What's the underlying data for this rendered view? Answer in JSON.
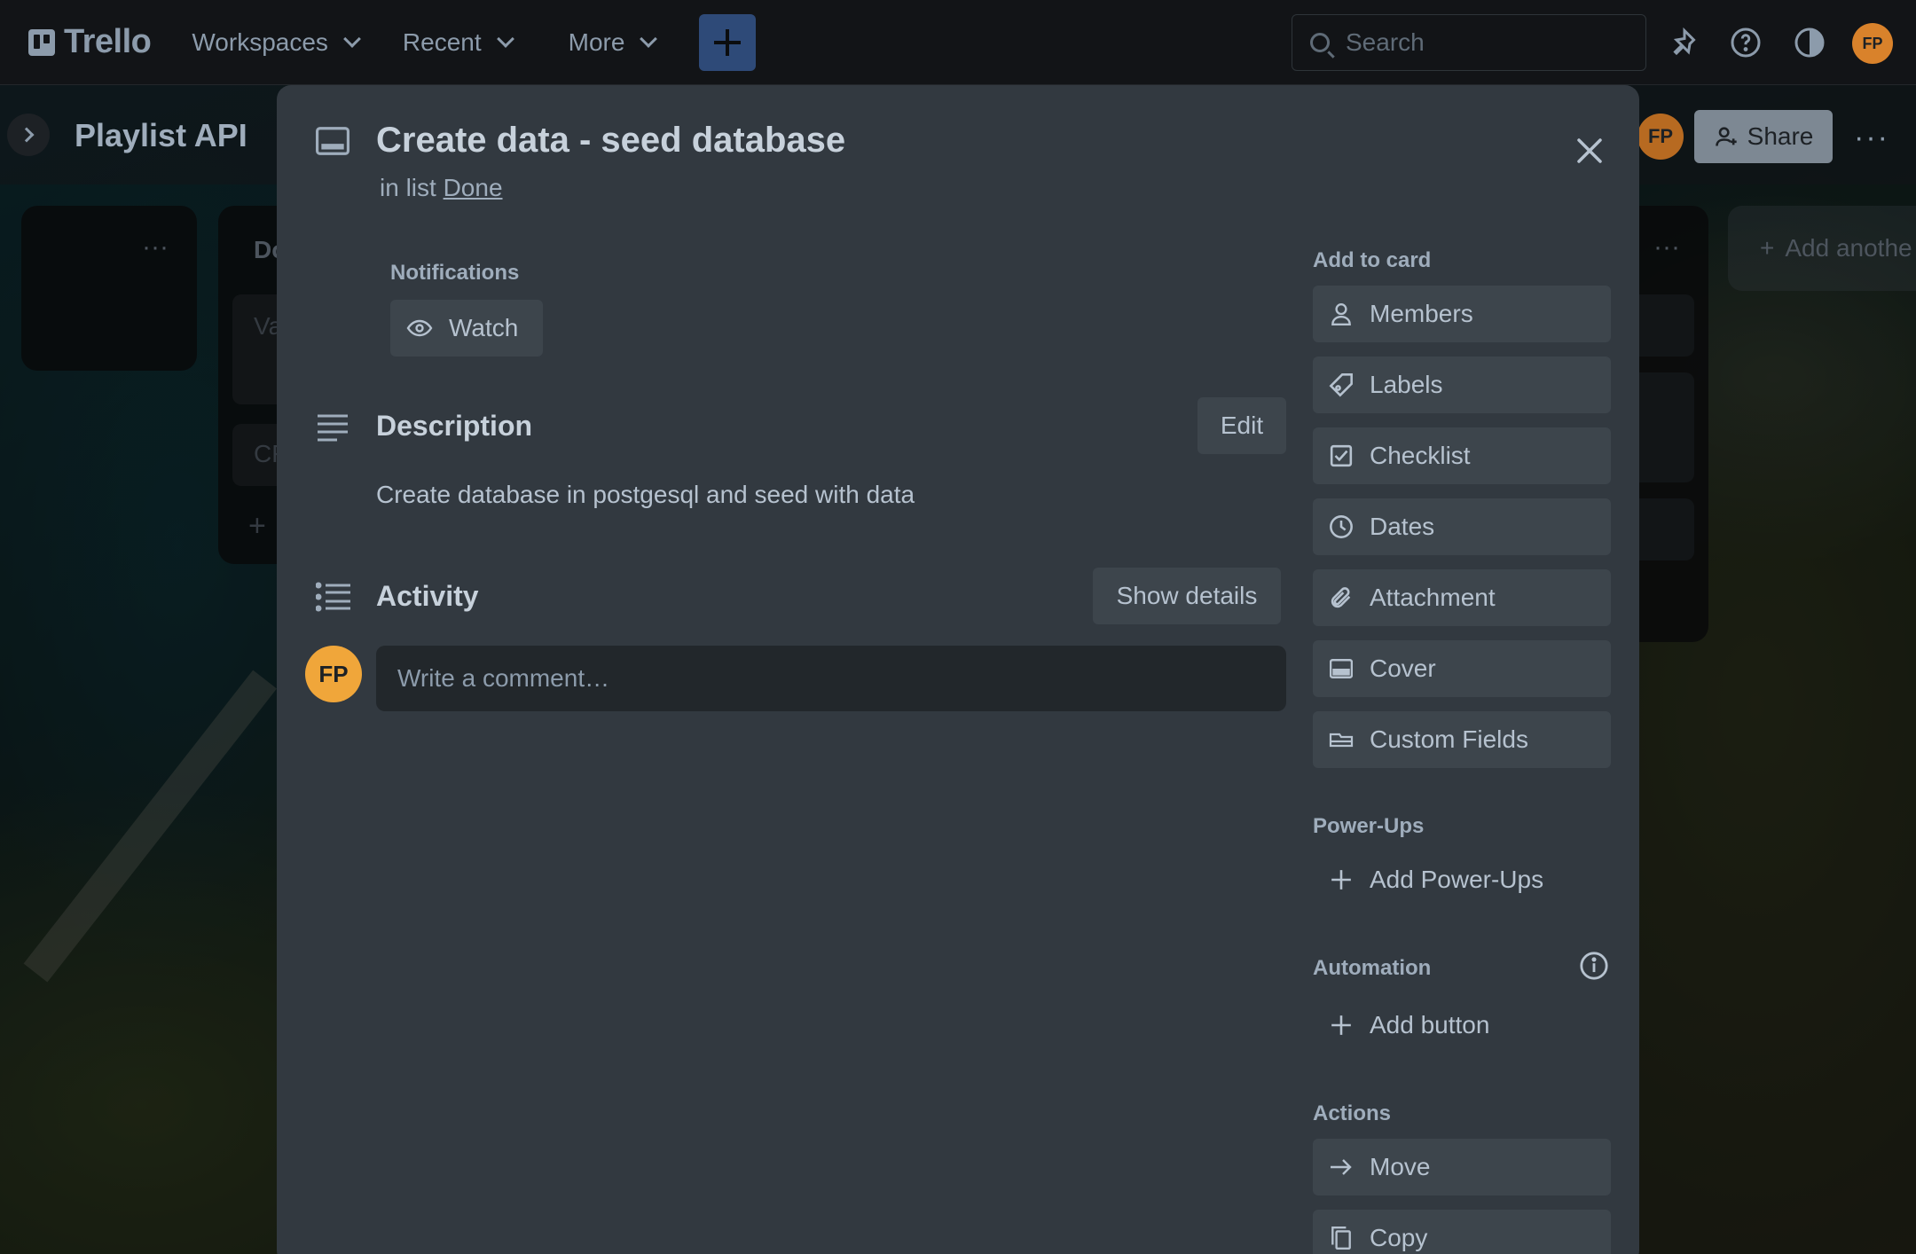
{
  "topnav": {
    "logo": "Trello",
    "menus": [
      "Workspaces",
      "Recent",
      "More"
    ],
    "search_placeholder": "Search",
    "user_initials": "FP"
  },
  "board": {
    "title": "Playlist API",
    "share_label": "Share",
    "member_initials": "FP",
    "add_list_label": "Add anothe",
    "list_partial_title": "Do",
    "card_partial_1": "Va",
    "card_partial_2": "CF"
  },
  "modal": {
    "title": "Create data - seed database",
    "in_list_prefix": "in list",
    "list_name": "Done",
    "notifications_label": "Notifications",
    "watch_label": "Watch",
    "description_title": "Description",
    "edit_label": "Edit",
    "description_text": "Create database in postgesql and seed with data",
    "activity_title": "Activity",
    "show_details_label": "Show details",
    "comment_avatar": "FP",
    "comment_placeholder": "Write a comment…"
  },
  "sidebar": {
    "add_to_card_label": "Add to card",
    "add_to_card": [
      {
        "label": "Members",
        "icon": "person-icon"
      },
      {
        "label": "Labels",
        "icon": "tag-icon"
      },
      {
        "label": "Checklist",
        "icon": "checkbox-icon"
      },
      {
        "label": "Dates",
        "icon": "clock-icon"
      },
      {
        "label": "Attachment",
        "icon": "paperclip-icon"
      },
      {
        "label": "Cover",
        "icon": "cover-icon"
      },
      {
        "label": "Custom Fields",
        "icon": "custom-fields-icon"
      }
    ],
    "power_ups_label": "Power-Ups",
    "add_power_ups": "Add Power-Ups",
    "automation_label": "Automation",
    "add_button": "Add button",
    "actions_label": "Actions",
    "actions": [
      {
        "label": "Move",
        "icon": "arrow-right-icon"
      },
      {
        "label": "Copy",
        "icon": "copy-icon"
      }
    ]
  }
}
